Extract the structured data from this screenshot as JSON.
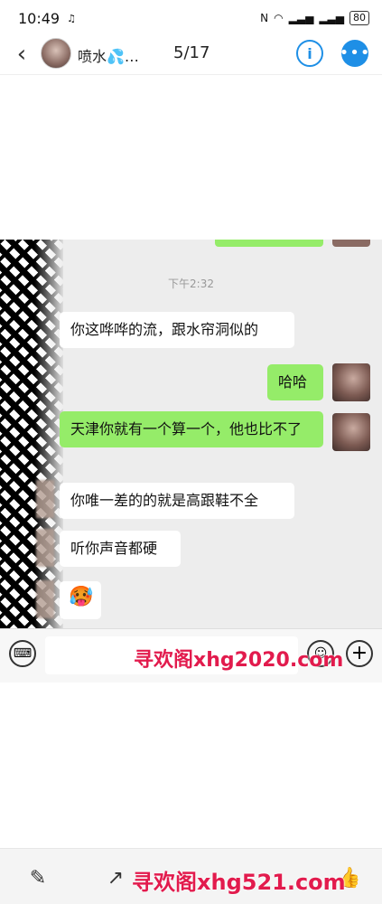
{
  "status_bar": {
    "time": "10:49",
    "battery": "80"
  },
  "header": {
    "name": "喷水💦…",
    "pager": "5/17"
  },
  "chat": {
    "timestamp": "下午2:32",
    "messages": [
      {
        "side": "in",
        "text": "你这哗哗的流，跟水帘洞似的"
      },
      {
        "side": "out",
        "text": "哈哈"
      },
      {
        "side": "out",
        "text": "天津你就有一个算一个，他也比不了"
      },
      {
        "side": "in",
        "text": "你唯一差的的就是高跟鞋不全"
      },
      {
        "side": "in",
        "text": "听你声音都硬"
      },
      {
        "side": "in",
        "text": "🥵"
      }
    ]
  },
  "watermarks": {
    "middle": "寻欢阁xhg2020.com",
    "bottom": "寻欢阁xhg521.com"
  },
  "icons": {
    "back": "back-arrow-icon",
    "info": "info-icon",
    "more": "more-icon",
    "keyboard": "keyboard-icon",
    "emoji": "emoji-icon",
    "plus": "plus-icon",
    "edit": "edit-icon",
    "share": "share-icon",
    "like": "like-icon"
  },
  "colors": {
    "accent": "#1e8fe6",
    "outgoing_bubble": "#95ec69",
    "watermark": "#e21b4d"
  }
}
